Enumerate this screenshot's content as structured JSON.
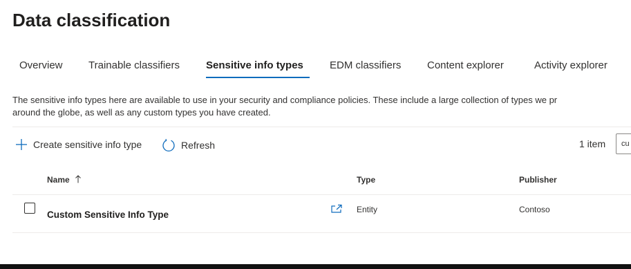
{
  "page": {
    "title": "Data classification",
    "tabs": [
      {
        "label": "Overview"
      },
      {
        "label": "Trainable classifiers"
      },
      {
        "label": "Sensitive info types"
      },
      {
        "label": "EDM classifiers"
      },
      {
        "label": "Content explorer"
      },
      {
        "label": "Activity explorer"
      }
    ],
    "active_tab": "Sensitive info types",
    "description_line1": "The sensitive info types here are available to use in your security and compliance policies. These include a large collection of types we pr",
    "description_line2": "around the globe, as well as any custom types you have created."
  },
  "toolbar": {
    "create_label": "Create sensitive info type",
    "refresh_label": "Refresh",
    "item_count": "1 item",
    "search_value": "cu"
  },
  "table": {
    "columns": {
      "name": "Name",
      "type": "Type",
      "publisher": "Publisher"
    },
    "rows": [
      {
        "name": "Custom Sensitive Info Type",
        "type": "Entity",
        "publisher": "Contoso"
      }
    ]
  },
  "colors": {
    "accent": "#0f6cbd",
    "text": "#323130",
    "divider": "#edebe9"
  },
  "icons": {
    "create": "plus-icon",
    "refresh": "refresh-icon",
    "sort": "sort-ascending-icon",
    "row_action": "open-in-new-icon"
  }
}
